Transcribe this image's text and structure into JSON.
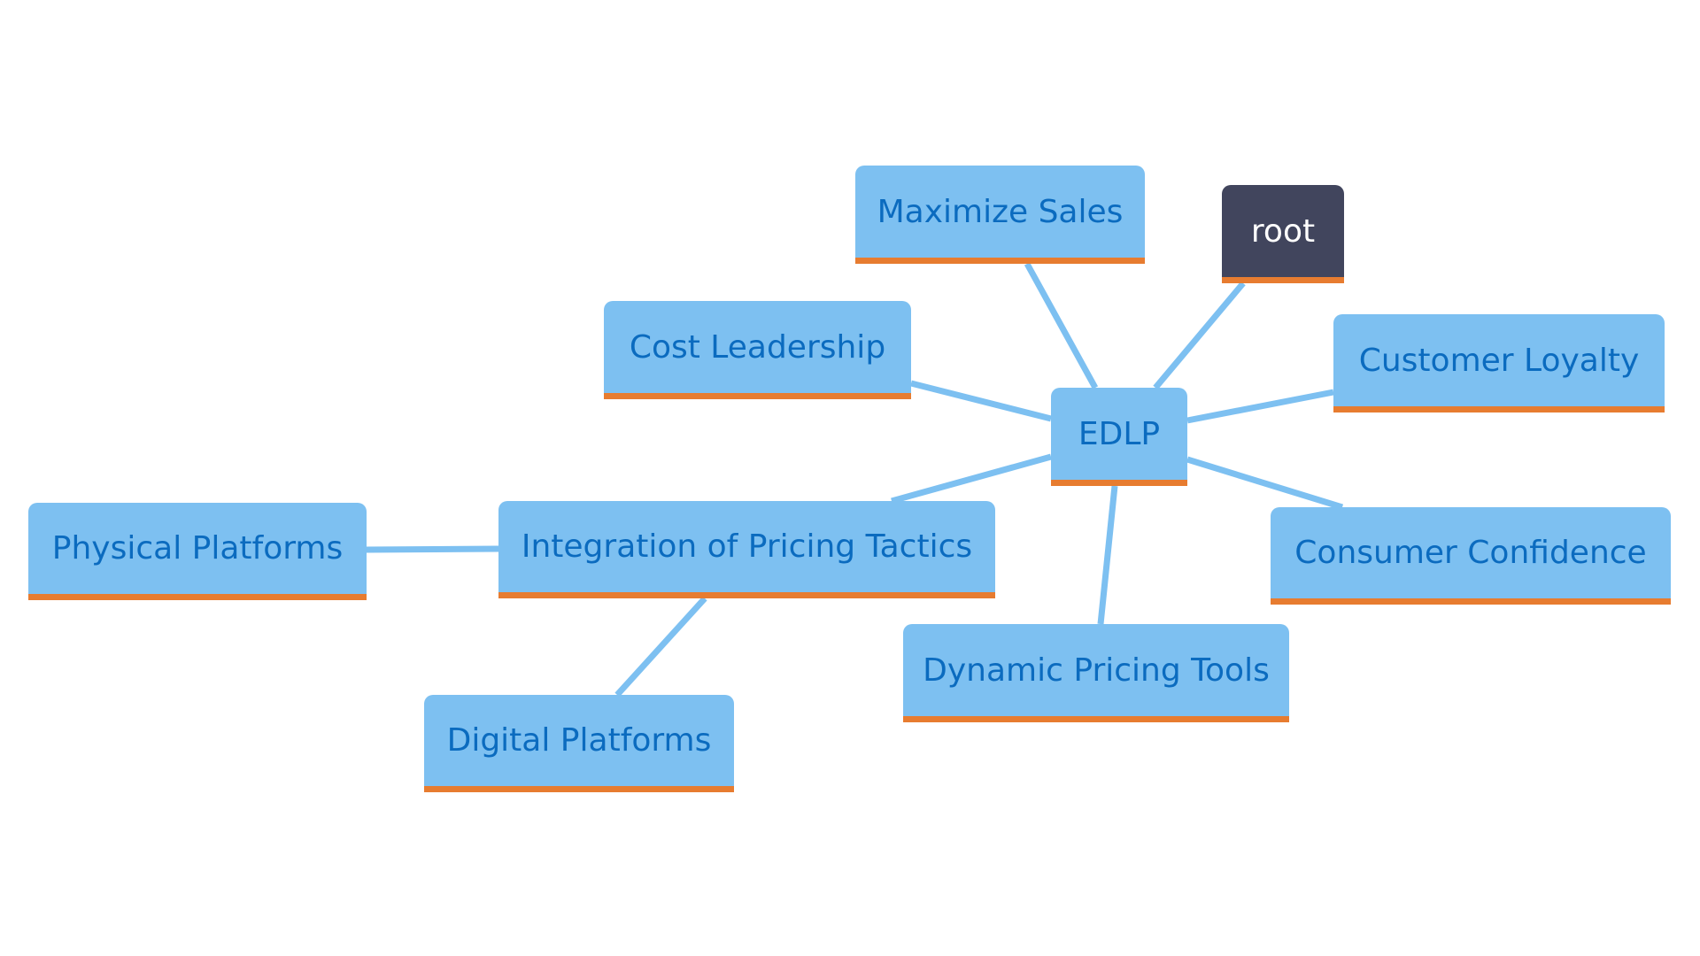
{
  "colors": {
    "node_fill": "#7dc0f1",
    "node_text": "#0b6bbf",
    "accent_border": "#e77c30",
    "root_fill": "#41455d",
    "edge": "#7dc0f1"
  },
  "nodes": {
    "edlp": "EDLP",
    "root": "root",
    "maximize_sales": "Maximize Sales",
    "cost_leadership": "Cost Leadership",
    "customer_loyalty": "Customer Loyalty",
    "consumer_confidence": "Consumer Confidence",
    "dynamic_pricing_tools": "Dynamic Pricing Tools",
    "integration": "Integration of Pricing Tactics",
    "physical_platforms": "Physical Platforms",
    "digital_platforms": "Digital Platforms"
  },
  "edges": [
    [
      "edlp",
      "root"
    ],
    [
      "edlp",
      "maximize_sales"
    ],
    [
      "edlp",
      "cost_leadership"
    ],
    [
      "edlp",
      "customer_loyalty"
    ],
    [
      "edlp",
      "consumer_confidence"
    ],
    [
      "edlp",
      "dynamic_pricing_tools"
    ],
    [
      "edlp",
      "integration"
    ],
    [
      "integration",
      "physical_platforms"
    ],
    [
      "integration",
      "digital_platforms"
    ]
  ]
}
